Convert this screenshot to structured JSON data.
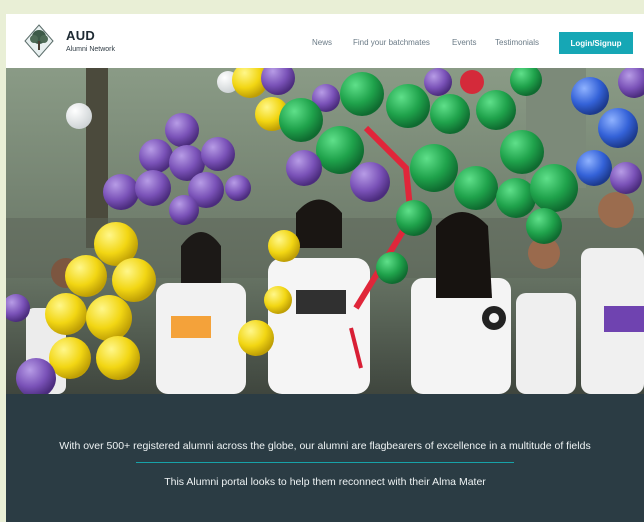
{
  "brand": {
    "title": "AUD",
    "subtitle": "Alumni Network",
    "logo_icon": "tree-logo-icon"
  },
  "nav": {
    "items": [
      {
        "label": "News"
      },
      {
        "label": "Find your batchmates"
      },
      {
        "label": "Events"
      },
      {
        "label": "Testimonials"
      }
    ],
    "login_label": "Login/Signup"
  },
  "hero": {
    "image_desc": "photo of students in white t-shirts celebrating with colorful balloons"
  },
  "banner": {
    "line1": "With over 500+ registered alumni across the globe, our alumni are flagbearers of excellence in a multitude of fields",
    "line2": "This Alumni portal looks to help them reconnect with their Alma Mater"
  },
  "colors": {
    "accent": "#16a7b5",
    "banner_bg": "#2b3c44",
    "page_bg": "#e9efd6"
  }
}
